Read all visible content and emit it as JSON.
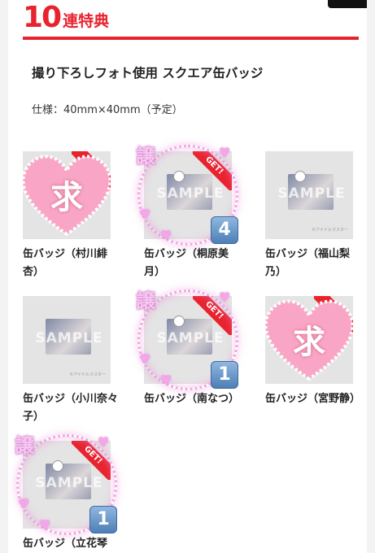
{
  "header": {
    "number": "10",
    "text": "連特典"
  },
  "product_title": "撮り下ろしフォト使用 スクエア缶バッジ",
  "spec": "仕様：40mm×40mm（予定）",
  "get_ribbon_text": "GET!",
  "sample_text": "SAMPLE",
  "copyright_text": "©アイドルマスター",
  "items": [
    {
      "label": "缶バッジ（村川緋杏）",
      "status": "求",
      "count": ""
    },
    {
      "label": "缶バッジ（桐原美月）",
      "status": "譲",
      "count": "4"
    },
    {
      "label": "缶バッジ（福山梨乃）",
      "status": "",
      "count": ""
    },
    {
      "label": "缶バッジ（小川奈々子）",
      "status": "",
      "count": ""
    },
    {
      "label": "缶バッジ（南なつ）",
      "status": "譲",
      "count": "1"
    },
    {
      "label": "缶バッジ（宮野静）",
      "status": "求",
      "count": ""
    },
    {
      "label": "缶バッジ（立花琴",
      "status": "譲",
      "count": "1"
    }
  ],
  "colors": {
    "accent": "#e8232e",
    "badge": "#4e7fb6",
    "heart": "#f9a6c6"
  }
}
